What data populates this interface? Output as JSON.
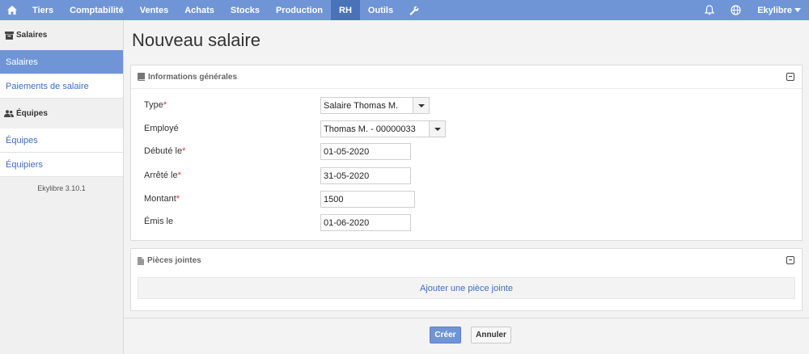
{
  "topnav": {
    "items": [
      "Tiers",
      "Comptabilité",
      "Ventes",
      "Achats",
      "Stocks",
      "Production",
      "RH",
      "Outils"
    ],
    "active_item": "RH",
    "user_menu": "Ekylibre"
  },
  "sidebar": {
    "section_salaires": "Salaires",
    "item_salaires": "Salaires",
    "item_paiements": "Paiements de salaire",
    "section_equipes": "Équipes",
    "item_equipes": "Équipes",
    "item_equipiers": "Équipiers",
    "version": "Ekylibre 3.10.1"
  },
  "page": {
    "title": "Nouveau salaire"
  },
  "general_panel": {
    "title": "Informations générales",
    "fields": {
      "type_label": "Type",
      "type_value": "Salaire Thomas M.",
      "employee_label": "Employé",
      "employee_value": "Thomas M. - 00000033",
      "started_label": "Débuté le",
      "started_value": "01-05-2020",
      "stopped_label": "Arrêté le",
      "stopped_value": "31-05-2020",
      "amount_label": "Montant",
      "amount_value": "1500",
      "emitted_label": "Émis le",
      "emitted_value": "01-06-2020"
    },
    "required_marker": "*"
  },
  "attachments_panel": {
    "title": "Pièces jointes",
    "add_label": "Ajouter une pièce jointe"
  },
  "actions": {
    "create_label": "Créer",
    "cancel_label": "Annuler"
  },
  "colors": {
    "accent": "#6f95d7",
    "accent_dark": "#4a72b8",
    "link": "#3d6ec4",
    "required": "#dd3333"
  }
}
